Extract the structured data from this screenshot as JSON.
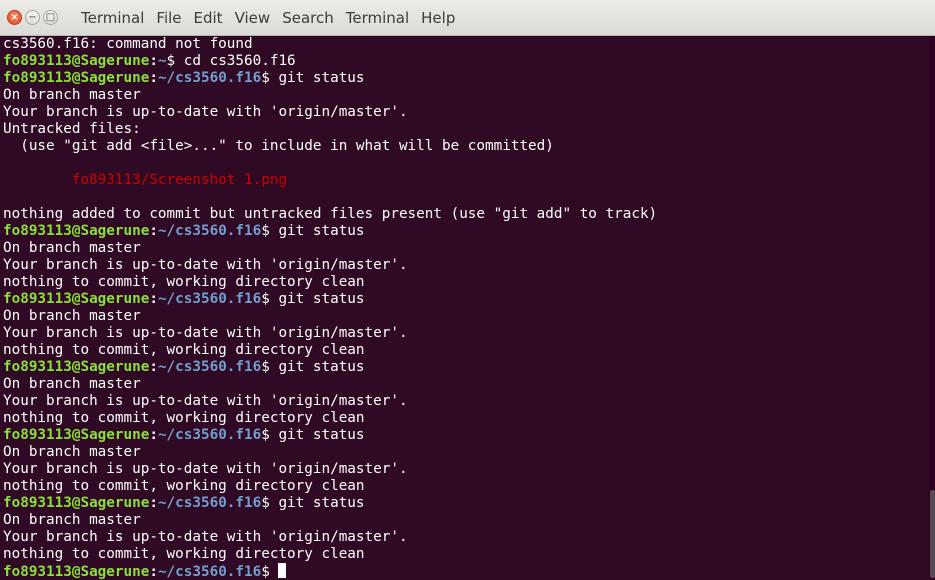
{
  "window": {
    "menu": [
      "Terminal",
      "File",
      "Edit",
      "View",
      "Search",
      "Terminal",
      "Help"
    ],
    "buttons": {
      "close": "×",
      "minimize": "−",
      "maximize": "□"
    }
  },
  "colors": {
    "background": "#300a24",
    "text": "#ffffff",
    "prompt_user": "#8ae234",
    "prompt_path": "#729fcf",
    "untracked_file": "#cc0000"
  },
  "terminal": {
    "lines": [
      {
        "type": "out",
        "text": "cs3560.f16: command not found"
      },
      {
        "type": "prompt",
        "user": "fo893113@Sagerune",
        "path": "~",
        "cmd": "$ cd cs3560.f16"
      },
      {
        "type": "prompt",
        "user": "fo893113@Sagerune",
        "path": "~/cs3560.f16",
        "cmd": "$ git status"
      },
      {
        "type": "out",
        "text": "On branch master"
      },
      {
        "type": "out",
        "text": "Your branch is up-to-date with 'origin/master'."
      },
      {
        "type": "out",
        "text": "Untracked files:"
      },
      {
        "type": "out",
        "text": "  (use \"git add <file>...\" to include in what will be committed)"
      },
      {
        "type": "out",
        "text": ""
      },
      {
        "type": "untracked",
        "text": "\tfo893113/Screenshot 1.png"
      },
      {
        "type": "out",
        "text": ""
      },
      {
        "type": "out",
        "text": "nothing added to commit but untracked files present (use \"git add\" to track)"
      },
      {
        "type": "prompt",
        "user": "fo893113@Sagerune",
        "path": "~/cs3560.f16",
        "cmd": "$ git status"
      },
      {
        "type": "out",
        "text": "On branch master"
      },
      {
        "type": "out",
        "text": "Your branch is up-to-date with 'origin/master'."
      },
      {
        "type": "out",
        "text": "nothing to commit, working directory clean"
      },
      {
        "type": "prompt",
        "user": "fo893113@Sagerune",
        "path": "~/cs3560.f16",
        "cmd": "$ git status"
      },
      {
        "type": "out",
        "text": "On branch master"
      },
      {
        "type": "out",
        "text": "Your branch is up-to-date with 'origin/master'."
      },
      {
        "type": "out",
        "text": "nothing to commit, working directory clean"
      },
      {
        "type": "prompt",
        "user": "fo893113@Sagerune",
        "path": "~/cs3560.f16",
        "cmd": "$ git status"
      },
      {
        "type": "out",
        "text": "On branch master"
      },
      {
        "type": "out",
        "text": "Your branch is up-to-date with 'origin/master'."
      },
      {
        "type": "out",
        "text": "nothing to commit, working directory clean"
      },
      {
        "type": "prompt",
        "user": "fo893113@Sagerune",
        "path": "~/cs3560.f16",
        "cmd": "$ git status"
      },
      {
        "type": "out",
        "text": "On branch master"
      },
      {
        "type": "out",
        "text": "Your branch is up-to-date with 'origin/master'."
      },
      {
        "type": "out",
        "text": "nothing to commit, working directory clean"
      },
      {
        "type": "prompt",
        "user": "fo893113@Sagerune",
        "path": "~/cs3560.f16",
        "cmd": "$ git status"
      },
      {
        "type": "out",
        "text": "On branch master"
      },
      {
        "type": "out",
        "text": "Your branch is up-to-date with 'origin/master'."
      },
      {
        "type": "out",
        "text": "nothing to commit, working directory clean"
      },
      {
        "type": "prompt",
        "user": "fo893113@Sagerune",
        "path": "~/cs3560.f16",
        "cmd": "$ ",
        "cursor": true
      }
    ]
  }
}
